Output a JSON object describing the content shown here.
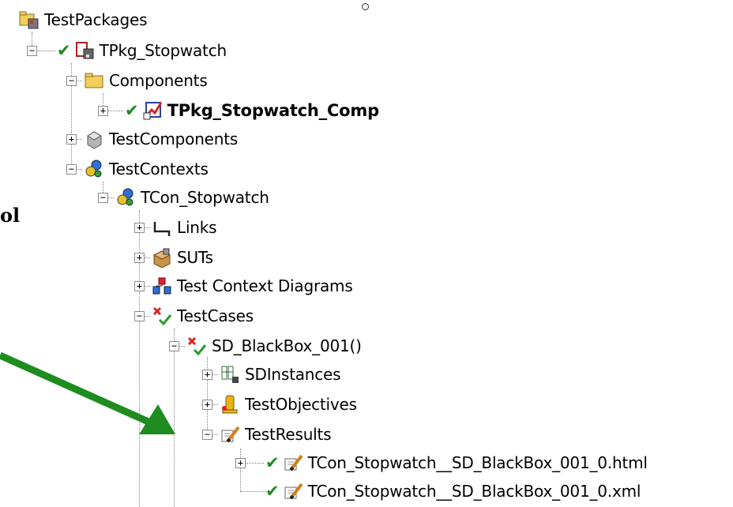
{
  "tree": {
    "root": "TestPackages",
    "package": "TPkg_Stopwatch",
    "components_folder": "Components",
    "component": "TPkg_Stopwatch_Comp",
    "test_components": "TestComponents",
    "test_contexts": "TestContexts",
    "context": "TCon_Stopwatch",
    "links": "Links",
    "suts": "SUTs",
    "diagrams": "Test Context Diagrams",
    "test_cases": "TestCases",
    "test_case": "SD_BlackBox_001()",
    "sd_instances": "SDInstances",
    "test_objectives": "TestObjectives",
    "test_results": "TestResults",
    "result_html": "TCon_Stopwatch__SD_BlackBox_001_0.html",
    "result_xml": "TCon_Stopwatch__SD_BlackBox_001_0.xml"
  },
  "side_label": "ol",
  "colors": {
    "arrow": "#1e8c1e",
    "check": "#1f8a1f",
    "folder": "#f2cf5c"
  },
  "icons": {
    "root": "package-folder-icon",
    "package": "package-icon",
    "folder": "folder-icon",
    "component": "component-diagram-icon",
    "test_components": "gray-component-icon",
    "test_contexts": "context-puzzle-icon",
    "links": "link-connector-icon",
    "suts": "sut-box-icon",
    "diagrams": "diagram-icon",
    "test_cases": "test-case-icon",
    "sd_instances": "sd-instances-icon",
    "test_objectives": "objectives-icon",
    "test_results": "results-pen-icon"
  }
}
